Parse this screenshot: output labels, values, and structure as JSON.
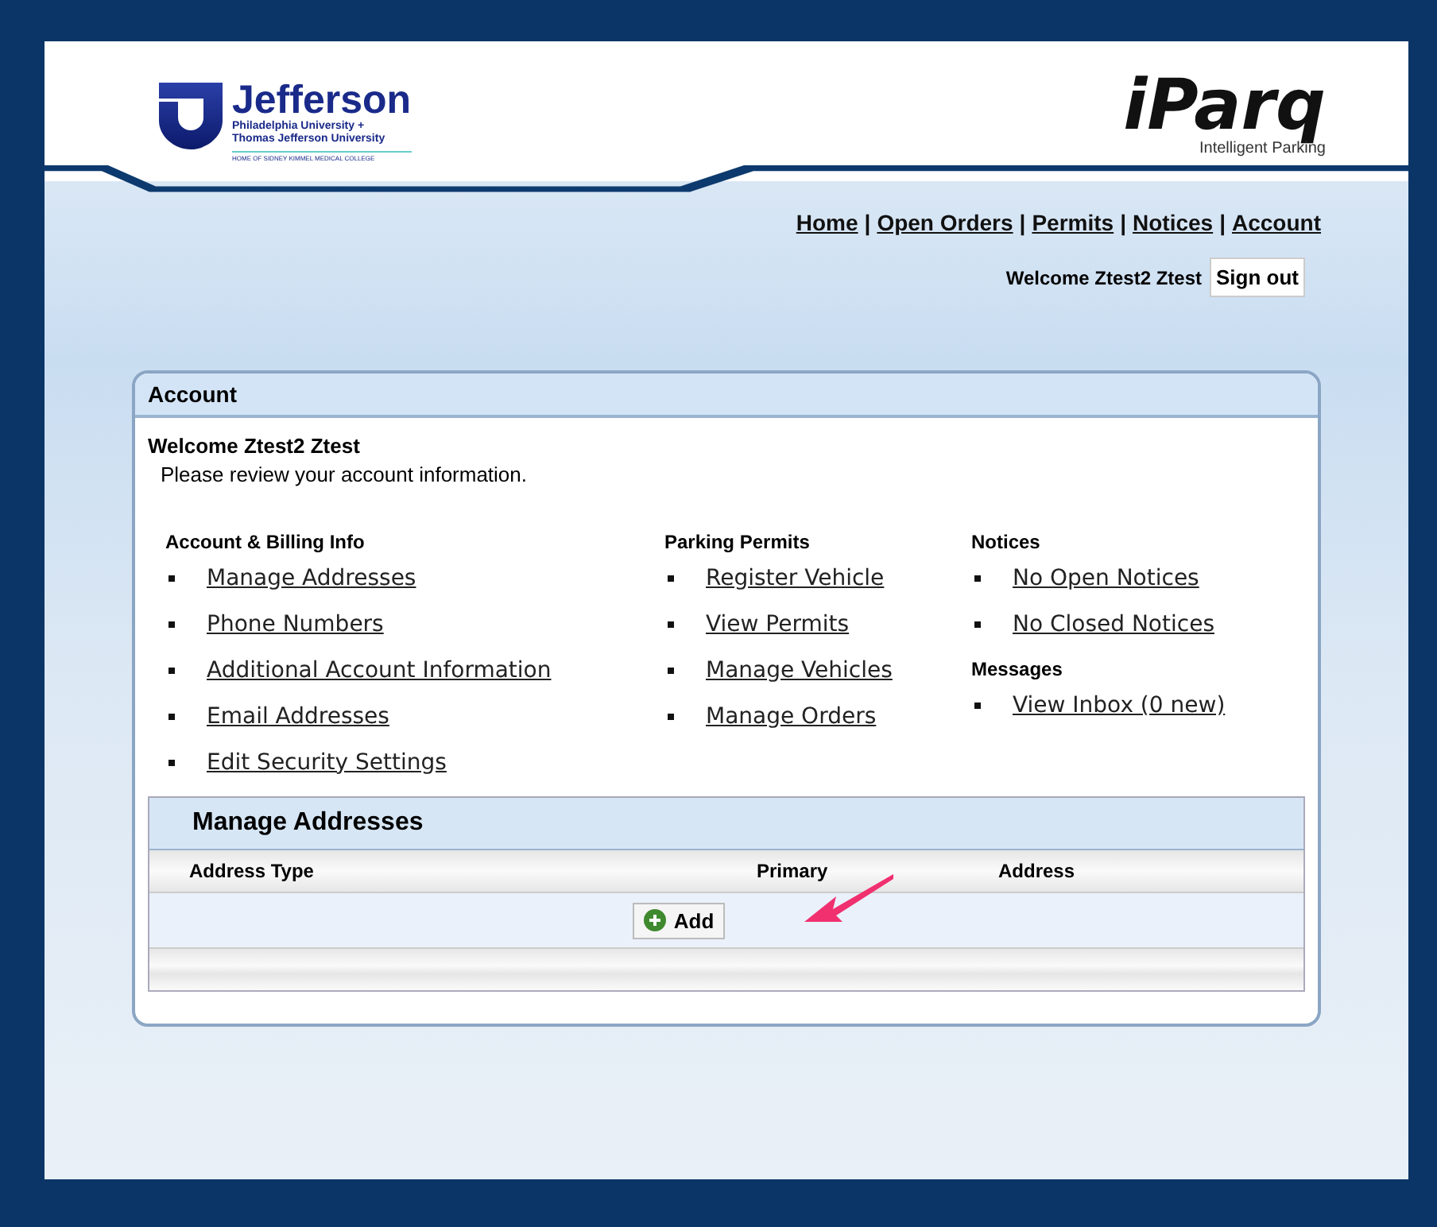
{
  "header": {
    "left_logo": {
      "name": "Jefferson",
      "line_1": "Philadelphia University +",
      "line_2": "Thomas Jefferson University",
      "tagline": "HOME OF SIDNEY KIMMEL MEDICAL COLLEGE"
    },
    "right_logo": {
      "name": "iParq",
      "tagline": "Intelligent Parking"
    }
  },
  "nav": {
    "separator": "|",
    "links": [
      "Home",
      "Open Orders",
      "Permits",
      "Notices",
      "Account"
    ]
  },
  "user": {
    "welcome": "Welcome Ztest2 Ztest",
    "sign_out": "Sign out"
  },
  "panel": {
    "title": "Account",
    "welcome": "Welcome Ztest2 Ztest",
    "intro": "Please review your account information.",
    "columns": [
      {
        "sections": [
          {
            "heading": "Account & Billing Info",
            "links": [
              "Manage Addresses",
              "Phone Numbers",
              "Additional Account Information",
              "Email Addresses",
              "Edit Security Settings"
            ]
          }
        ]
      },
      {
        "sections": [
          {
            "heading": "Parking Permits",
            "links": [
              "Register Vehicle",
              "View Permits",
              "Manage Vehicles",
              "Manage Orders"
            ]
          }
        ]
      },
      {
        "sections": [
          {
            "heading": "Notices",
            "links": [
              "No Open Notices",
              "No Closed Notices"
            ]
          },
          {
            "heading": "Messages",
            "links": [
              "View Inbox (0 new)"
            ]
          }
        ]
      }
    ]
  },
  "manage": {
    "title": "Manage Addresses",
    "columns": [
      "Address Type",
      "Primary",
      "Address"
    ],
    "add_button": "Add"
  }
}
